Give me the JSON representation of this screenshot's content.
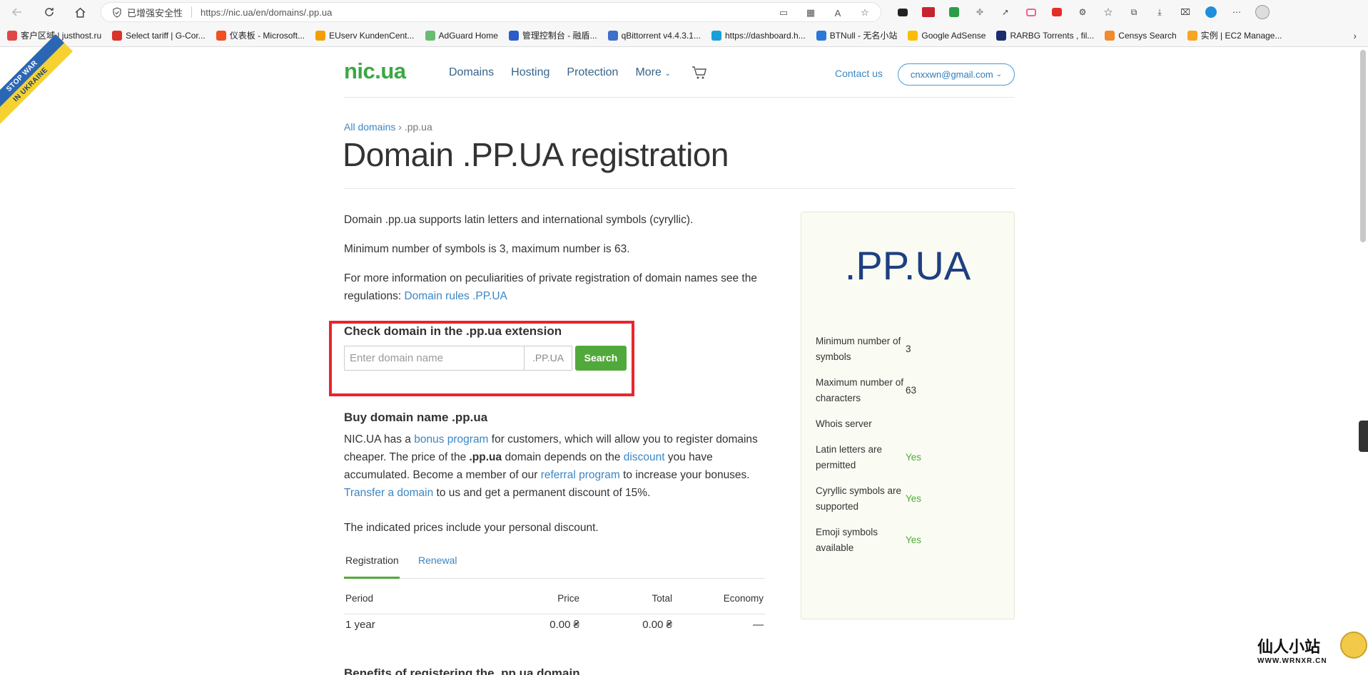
{
  "browser": {
    "security_label": "已增强安全性",
    "url": "https://nic.ua/en/domains/.pp.ua",
    "bookmarks": [
      {
        "label": "客户区域 | justhost.ru",
        "color": "#e04848"
      },
      {
        "label": "Select tariff | G-Cor...",
        "color": "#d9342b"
      },
      {
        "label": "仪表板 - Microsoft...",
        "color": "#f25022"
      },
      {
        "label": "EUserv KundenCent...",
        "color": "#f0a000"
      },
      {
        "label": "AdGuard Home",
        "color": "#68bc71"
      },
      {
        "label": "管理控制台 - 融盾...",
        "color": "#2b5cc7"
      },
      {
        "label": "qBittorrent v4.4.3.1...",
        "color": "#3d70c8"
      },
      {
        "label": "https://dashboard.h...",
        "color": "#1aa0d8"
      },
      {
        "label": "BTNull - 无名小站",
        "color": "#2a78d6"
      },
      {
        "label": "Google AdSense",
        "color": "#fbbc05"
      },
      {
        "label": "RARBG Torrents , fil...",
        "color": "#1a2e6e"
      },
      {
        "label": "Censys Search",
        "color": "#f08a2c"
      },
      {
        "label": "实例 | EC2 Manage...",
        "color": "#f5a623"
      }
    ]
  },
  "ribbon": {
    "line1": "STOP WAR",
    "line2": "IN UKRAINE"
  },
  "header": {
    "logo": "nic.ua",
    "nav": [
      "Domains",
      "Hosting",
      "Protection",
      "More"
    ],
    "contact": "Contact us",
    "user": "cnxxwn@gmail.com"
  },
  "breadcrumb": {
    "root": "All domains",
    "sep": " › ",
    "current": ".pp.ua"
  },
  "title": "Domain .PP.UA registration",
  "intro": {
    "p1": "Domain .pp.ua supports latin letters and international symbols (cyryllic).",
    "p2": "Minimum number of symbols is 3, maximum number is 63.",
    "p3_text": "For more information on peculiarities of private registration of domain names see the regulations: ",
    "p3_link": "Domain rules .PP.UA"
  },
  "check": {
    "title": "Check domain in the .pp.ua extension",
    "placeholder": "Enter domain name",
    "suffix": ".PP.UA",
    "button": "Search"
  },
  "buy": {
    "title": "Buy domain name .pp.ua",
    "t1": "NIC.UA has a ",
    "l1": "bonus program",
    "t2": " for customers, which will allow you to register domains cheaper. The price of the ",
    "b1": ".pp.ua",
    "t3": " domain depends on the ",
    "l2": "discount",
    "t4": " you have accumulated. Become a member of our ",
    "l3": "referral program",
    "t5": " to increase your bonuses. ",
    "l4": "Transfer a domain",
    "t6": " to us and get a permanent discount of 15%.",
    "note": "The indicated prices include your personal discount."
  },
  "tabs": {
    "registration": "Registration",
    "renewal": "Renewal"
  },
  "table": {
    "headers": [
      "Period",
      "Price",
      "Total",
      "Economy"
    ],
    "rows": [
      [
        "1 year",
        "0.00 ₴",
        "0.00 ₴",
        "—"
      ]
    ]
  },
  "cut_off_heading": "Benefits of registering the .pp.ua domain",
  "side": {
    "big": ".PP.UA",
    "rows": [
      {
        "key": "Minimum number of symbols",
        "value": "3",
        "yes": false
      },
      {
        "key": "Maximum number of characters",
        "value": "63",
        "yes": false
      },
      {
        "key": "Whois server",
        "value": "",
        "yes": false
      },
      {
        "key": "Latin letters are permitted",
        "value": "Yes",
        "yes": true
      },
      {
        "key": "Cyryllic symbols are supported",
        "value": "Yes",
        "yes": true
      },
      {
        "key": "Emoji symbols available",
        "value": "Yes",
        "yes": true
      }
    ]
  },
  "watermark": {
    "cn": "仙人小站",
    "en": "WWW.WRNXR.CN"
  },
  "colors": {
    "brand_green": "#52a93b",
    "link_blue": "#3b86c4",
    "highlight_red": "#e8262b",
    "title_navy": "#1f3f82"
  }
}
